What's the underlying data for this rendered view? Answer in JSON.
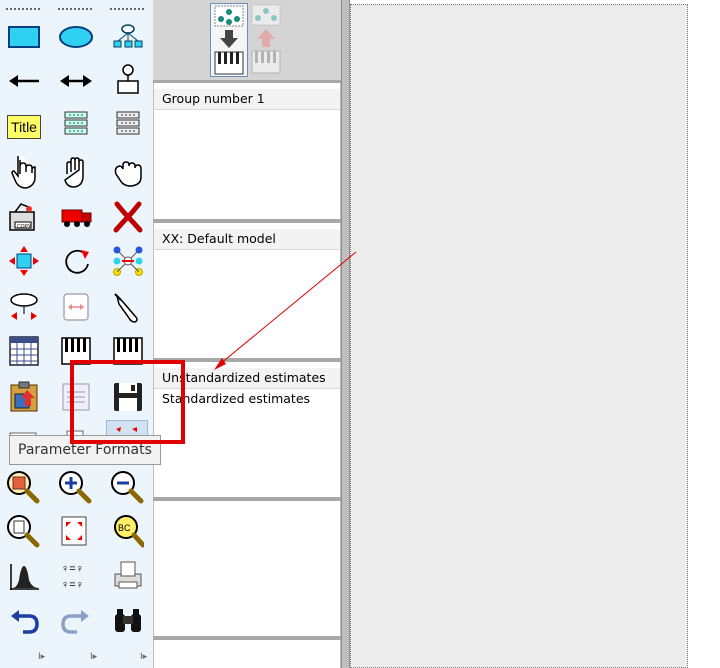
{
  "panels": {
    "groups": {
      "header": "Group number 1"
    },
    "models": {
      "header": "XX: Default model"
    },
    "estimates": {
      "items": [
        "Unstandardized estimates",
        "Standardized estimates"
      ]
    }
  },
  "tooltip": {
    "text": "Parameter Formats"
  },
  "toolbox": {
    "title_tool_label": "Title"
  },
  "colors": {
    "toolbox_bg": "#edf5fc",
    "highlight": "#e00000",
    "annotation_arrow": "#e00000"
  }
}
